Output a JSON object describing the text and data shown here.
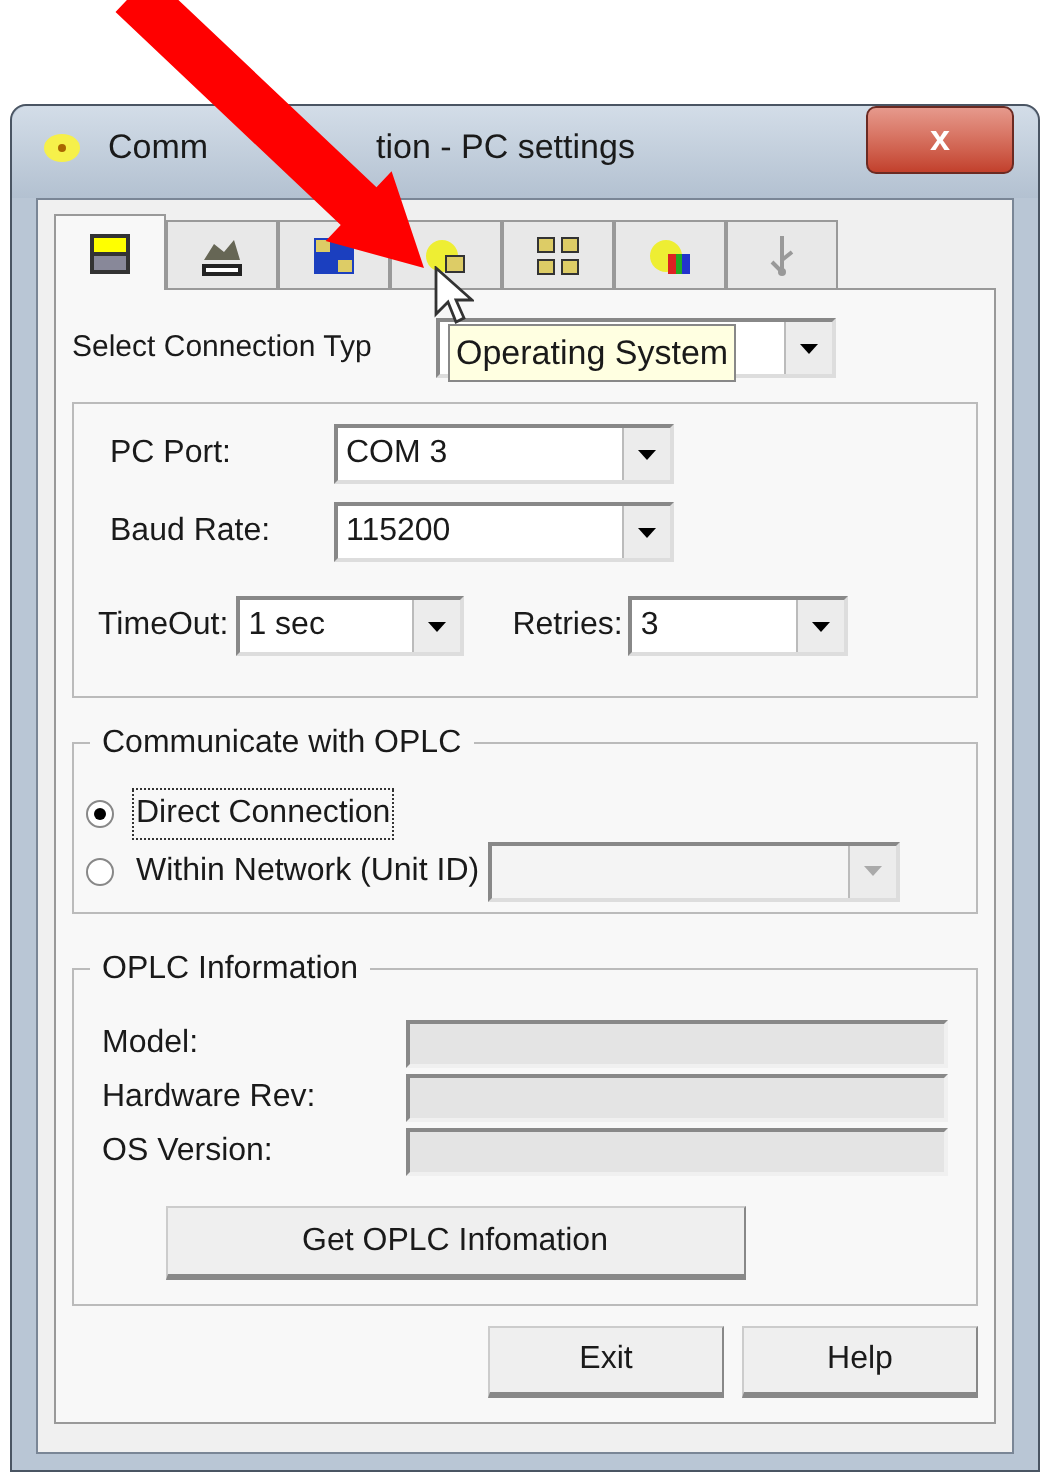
{
  "window": {
    "title_parts": [
      "Comm",
      "tion - PC settings"
    ],
    "close_label": "x"
  },
  "tabs": [
    {
      "selected": true
    },
    {
      "selected": false
    },
    {
      "selected": false
    },
    {
      "selected": false
    },
    {
      "selected": false
    },
    {
      "selected": false
    },
    {
      "selected": false
    }
  ],
  "connection_type": {
    "label": "Select Connection Typ"
  },
  "tooltip": "Operating System",
  "port_group": {
    "pc_port": {
      "label": "PC Port:",
      "value": "COM 3"
    },
    "baud_rate": {
      "label": "Baud Rate:",
      "value": "115200"
    },
    "timeout": {
      "label": "TimeOut:",
      "value": "1 sec"
    },
    "retries": {
      "label": "Retries:",
      "value": "3"
    }
  },
  "communicate_group": {
    "title": "Communicate with OPLC",
    "options": [
      {
        "label": "Direct Connection",
        "selected": true,
        "focused": true
      },
      {
        "label": "Within Network (Unit ID)",
        "selected": false,
        "focused": false
      }
    ],
    "unit_id": {
      "disabled": true
    }
  },
  "info_group": {
    "title": "OPLC Information",
    "fields": [
      {
        "label": "Model:"
      },
      {
        "label": "Hardware Rev:"
      },
      {
        "label": "OS Version:"
      }
    ],
    "button": "Get OPLC Infomation"
  },
  "buttons": [
    "Exit",
    "Help"
  ]
}
